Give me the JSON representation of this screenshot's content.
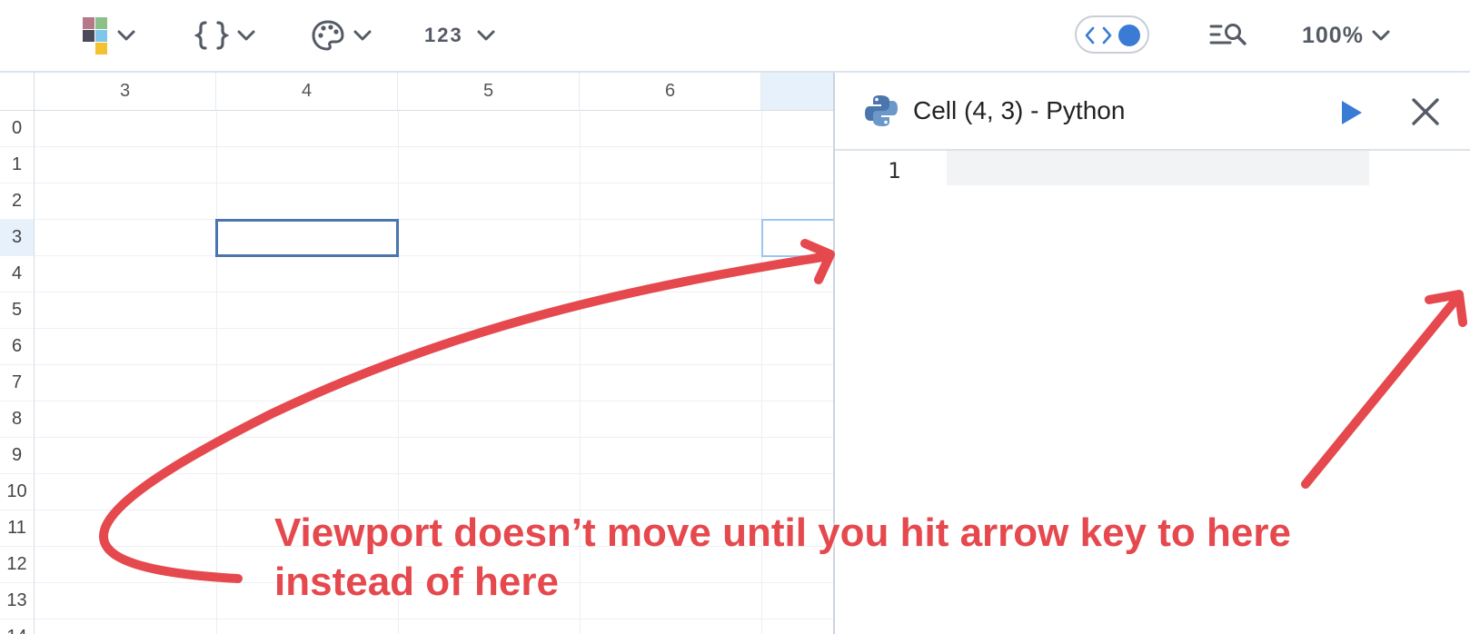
{
  "toolbar": {
    "icons": [
      "color-squares-icon",
      "braces-icon",
      "palette-icon",
      "number-format-icon",
      "code-toggle-icon",
      "search-list-icon"
    ],
    "number_format_label": "123",
    "zoom_label": "100%",
    "toggle_color": "#3a7bd5"
  },
  "grid": {
    "columns": [
      "3",
      "4",
      "5",
      "6"
    ],
    "rows": [
      "0",
      "1",
      "2",
      "3",
      "4",
      "5",
      "6",
      "7",
      "8",
      "9",
      "10",
      "11",
      "12",
      "13",
      "14"
    ],
    "selected_row": "3",
    "selected_cell": "(4, 3)"
  },
  "code_panel": {
    "title": "Cell (4, 3) - Python",
    "line_numbers": [
      "1"
    ],
    "code": "",
    "run_color": "#3a7bd5"
  },
  "annotation": {
    "line1": "Viewport doesn’t move until you hit arrow key to here",
    "line2": "instead of here",
    "color": "#e5484d"
  }
}
